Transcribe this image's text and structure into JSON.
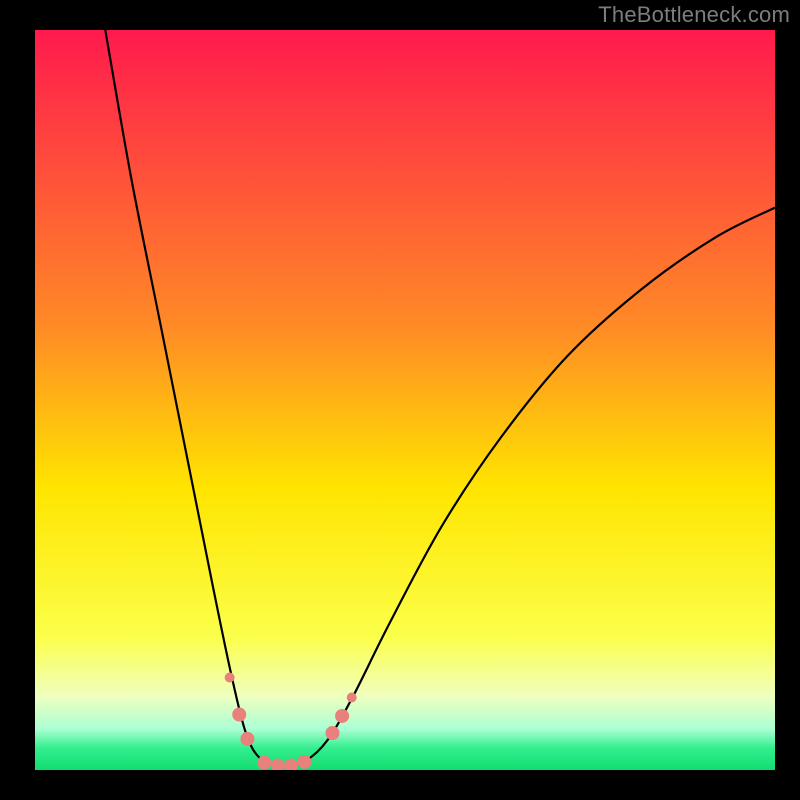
{
  "watermark": "TheBottleneck.com",
  "chart_data": {
    "type": "line",
    "title": "",
    "xlabel": "",
    "ylabel": "",
    "xlim": [
      0,
      100
    ],
    "ylim": [
      0,
      100
    ],
    "background_gradient": {
      "stops": [
        {
          "offset": 0.0,
          "color": "#ff1a4d"
        },
        {
          "offset": 0.4,
          "color": "#ff8a26"
        },
        {
          "offset": 0.62,
          "color": "#ffe500"
        },
        {
          "offset": 0.82,
          "color": "#fbff4a"
        },
        {
          "offset": 0.9,
          "color": "#f0ffbf"
        },
        {
          "offset": 0.945,
          "color": "#aaffd3"
        },
        {
          "offset": 0.97,
          "color": "#33ef8e"
        },
        {
          "offset": 1.0,
          "color": "#12dd70"
        }
      ]
    },
    "series": [
      {
        "name": "bottleneck-curve",
        "stroke": "#000000",
        "stroke_width": 2.2,
        "points": [
          {
            "x": 9.5,
            "y": 100
          },
          {
            "x": 13,
            "y": 80
          },
          {
            "x": 17,
            "y": 60
          },
          {
            "x": 21,
            "y": 40
          },
          {
            "x": 24,
            "y": 25
          },
          {
            "x": 26.5,
            "y": 13
          },
          {
            "x": 28.5,
            "y": 5
          },
          {
            "x": 30.5,
            "y": 1.5
          },
          {
            "x": 33.5,
            "y": 0.5
          },
          {
            "x": 36.5,
            "y": 1.2
          },
          {
            "x": 39.5,
            "y": 4
          },
          {
            "x": 43,
            "y": 10
          },
          {
            "x": 48,
            "y": 20
          },
          {
            "x": 55,
            "y": 33
          },
          {
            "x": 63,
            "y": 45
          },
          {
            "x": 72,
            "y": 56
          },
          {
            "x": 82,
            "y": 65
          },
          {
            "x": 92,
            "y": 72
          },
          {
            "x": 100,
            "y": 76
          }
        ]
      }
    ],
    "markers": {
      "color": "#e8817b",
      "radius_small": 5,
      "radius_large": 7,
      "points": [
        {
          "x": 26.3,
          "y": 12.5,
          "r": "small"
        },
        {
          "x": 27.6,
          "y": 7.5,
          "r": "large"
        },
        {
          "x": 28.7,
          "y": 4.2,
          "r": "large"
        },
        {
          "x": 31.0,
          "y": 1.0,
          "r": "large"
        },
        {
          "x": 32.8,
          "y": 0.6,
          "r": "large"
        },
        {
          "x": 34.6,
          "y": 0.6,
          "r": "large"
        },
        {
          "x": 36.4,
          "y": 1.1,
          "r": "large"
        },
        {
          "x": 40.2,
          "y": 5.0,
          "r": "large"
        },
        {
          "x": 41.5,
          "y": 7.3,
          "r": "large"
        },
        {
          "x": 42.8,
          "y": 9.8,
          "r": "small"
        }
      ]
    }
  }
}
